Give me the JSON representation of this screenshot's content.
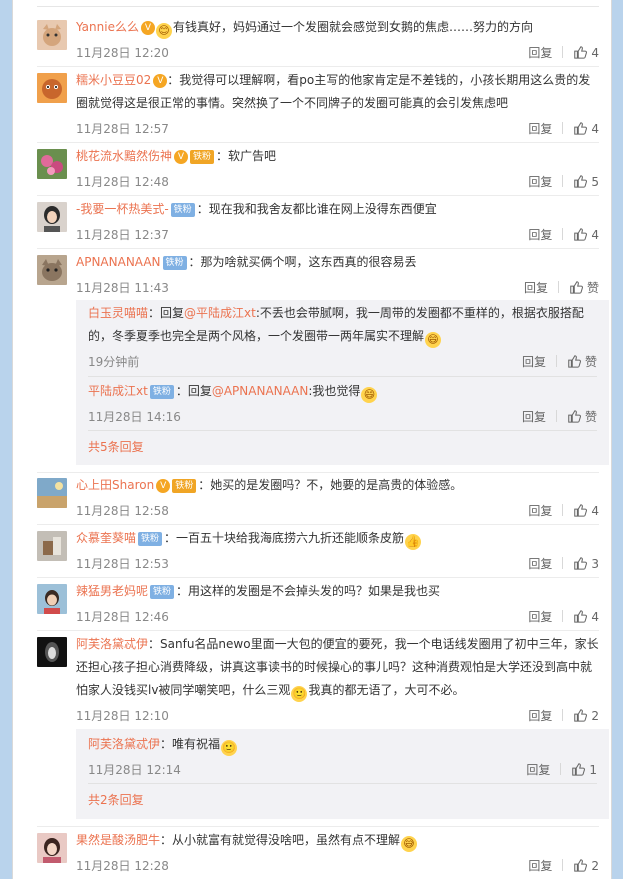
{
  "labels": {
    "reply": "回复",
    "like_zan": "赞"
  },
  "comments": [
    {
      "user": "Yannie么么",
      "badges": [
        "vip"
      ],
      "text": "有钱真好，妈妈通过一个发圈就会感觉到女鹅的焦虑……努力的方向",
      "time": "11月28日 12:20",
      "likes": "4"
    },
    {
      "user": "糯米小豆豆02",
      "badges": [
        "vip"
      ],
      "text": "：我觉得可以理解啊，看po主写的他家肯定是不差钱的，小孩长期用这么贵的发圈就觉得这是很正常的事情。突然换了一个不同牌子的发圈可能真的会引发焦虑吧",
      "time": "11月28日 12:57",
      "likes": "4"
    },
    {
      "user": "桃花流水黯然伤神",
      "badges": [
        "vip",
        "铁粉"
      ],
      "text": "：软广告吧",
      "time": "11月28日 12:48",
      "likes": "5"
    },
    {
      "user": "-我要一杯热美式-",
      "badges": [
        "铁粉"
      ],
      "text": "：现在我和我舍友都比谁在网上没得东西便宜",
      "time": "11月28日 12:37",
      "likes": "4"
    },
    {
      "user": "APNANANAAN",
      "badges": [
        "铁粉"
      ],
      "text": "：那为啥就买俩个啊，这东西真的很容易丢",
      "time": "11月28日 11:43",
      "likes": "赞",
      "replies": [
        {
          "user": "白玉灵喵喵",
          "text": "：回复",
          "mention": "@平陆成江xt",
          "text2": ":不丢也会带腻啊，我一周带的发圈都不重样的，根据衣服搭配的，冬季夏季也完全是两个风格，一个发圈带一两年属实不理解",
          "time": "19分钟前",
          "likes": "赞"
        },
        {
          "user": "平陆成江xt",
          "badges": [
            "铁粉"
          ],
          "text": "：回复",
          "mention": "@APNANANAAN",
          "text2": ":我也觉得",
          "time": "11月28日 14:16",
          "likes": "赞"
        }
      ],
      "more": "共5条回复"
    },
    {
      "user": "心上田Sharon",
      "badges": [
        "vip",
        "铁粉"
      ],
      "text": "：她买的是发圈吗？不，她要的是高贵的体验感。",
      "time": "11月28日 12:58",
      "likes": "4"
    },
    {
      "user": "众慕奎葵喵",
      "badges": [
        "铁粉"
      ],
      "text": "：一百五十块给我海底捞六九折还能顺条皮筋",
      "time": "11月28日 12:53",
      "likes": "3"
    },
    {
      "user": "辣猛男老妈呢",
      "badges": [
        "铁粉"
      ],
      "text": "：用这样的发圈是不会掉头发的吗？如果是我也买",
      "time": "11月28日 12:46",
      "likes": "4"
    },
    {
      "user": "阿芙洛黛忒伊",
      "badges": [],
      "text": "：Sanfu名品newo里面一大包的便宜的要死，我一个电话线发圈用了初中三年，家长还担心孩子担心消费降级，讲真这事读书的时候操心的事儿吗？这种消费观怕是大学还没到高中就怕家人没钱买lv被同学嘲笑吧，什么三观",
      "text2": "我真的都无语了，大可不必。",
      "time": "11月28日 12:10",
      "likes": "2",
      "replies": [
        {
          "user": "阿芙洛黛忒伊",
          "text": "：唯有祝福",
          "time": "11月28日 12:14",
          "likes": "1"
        }
      ],
      "more": "共2条回复"
    },
    {
      "user": "果然是酸汤肥牛",
      "badges": [],
      "text": "：从小就富有就觉得没啥吧，虽然有点不理解",
      "time": "11月28日 12:28",
      "likes": "2"
    }
  ],
  "icons": {
    "like": "thumbs-up-icon",
    "emoji": "emoji-icon"
  },
  "colors": {
    "username": "#eb7350",
    "badge": "#7fb0e3",
    "vip": "#f5a623",
    "background": "#b9d3ec"
  }
}
